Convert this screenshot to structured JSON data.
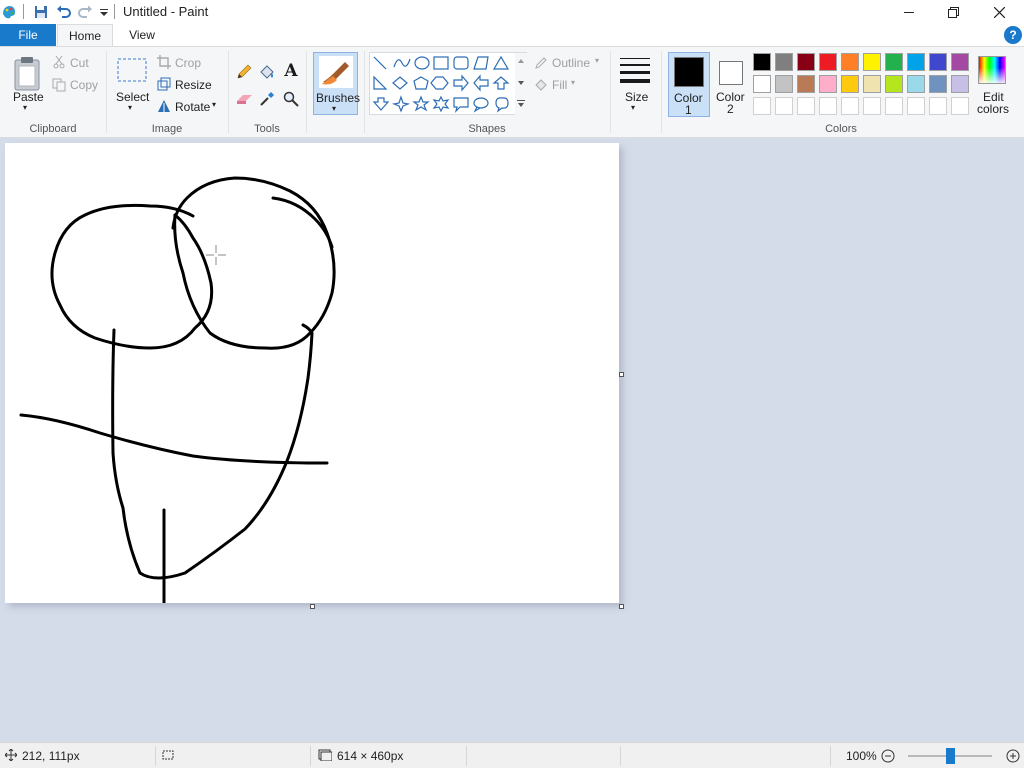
{
  "window": {
    "title": "Untitled - Paint"
  },
  "tabs": [
    {
      "label": "File"
    },
    {
      "label": "Home"
    },
    {
      "label": "View"
    }
  ],
  "clipboard": {
    "paste": "Paste",
    "cut": "Cut",
    "copy": "Copy",
    "group": "Clipboard"
  },
  "image": {
    "select": "Select",
    "crop": "Crop",
    "resize": "Resize",
    "rotate": "Rotate",
    "group": "Image"
  },
  "tools": {
    "group": "Tools"
  },
  "brushes": {
    "label": "Brushes"
  },
  "shapes": {
    "outline": "Outline",
    "fill": "Fill",
    "group": "Shapes"
  },
  "size": {
    "label": "Size"
  },
  "colors": {
    "color1_line1": "Color",
    "color1_line2": "1",
    "color2_line1": "Color",
    "color2_line2": "2",
    "edit_line1": "Edit",
    "edit_line2": "colors",
    "group": "Colors",
    "color1_value": "#000000",
    "color2_value": "#ffffff",
    "palette_row1": [
      "#000000",
      "#7f7f7f",
      "#880015",
      "#ed1c24",
      "#ff7f27",
      "#fff200",
      "#22b14c",
      "#00a2e8",
      "#3f48cc",
      "#a349a4"
    ],
    "palette_row2": [
      "#ffffff",
      "#c3c3c3",
      "#b97a57",
      "#ffaec9",
      "#ffc90e",
      "#efe4b0",
      "#b5e61d",
      "#99d9ea",
      "#7092be",
      "#c8bfe7"
    ],
    "palette_row3": [
      "#ffffff",
      "#ffffff",
      "#ffffff",
      "#ffffff",
      "#ffffff",
      "#ffffff",
      "#ffffff",
      "#ffffff",
      "#ffffff",
      "#ffffff"
    ]
  },
  "status": {
    "cursor_pos": "212, 111px",
    "canvas_size": "614 × 460px",
    "zoom": "100%"
  },
  "accent": "#1979ca"
}
